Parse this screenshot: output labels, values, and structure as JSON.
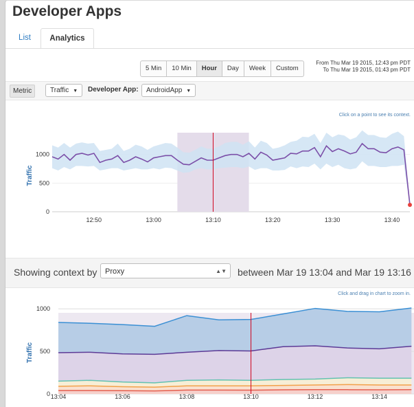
{
  "header": {
    "title": "Developer Apps"
  },
  "tabs": [
    {
      "label": "List"
    },
    {
      "label": "Analytics"
    }
  ],
  "time_range": {
    "options": [
      "5 Min",
      "10 Min",
      "Hour",
      "Day",
      "Week",
      "Custom"
    ],
    "selected": "Hour",
    "from_text": "From Thu Mar 19 2015, 12:43 pm PDT",
    "to_text": "To Thu Mar 19 2015, 01:43 pm PDT"
  },
  "filters": {
    "metric_label": "Metric",
    "metric_value": "Traffic",
    "app_label": "Developer App:",
    "app_value": "AndroidApp"
  },
  "chart1": {
    "hint": "Click on a point to see its context."
  },
  "context": {
    "label": "Showing context by",
    "dimension": "Proxy",
    "between_text": "between Mar 19 13:04 and Mar 19 13:16"
  },
  "chart2": {
    "hint": "Click and drag in chart to zoom in."
  },
  "colors": {
    "line1": "#7b4fa8",
    "band1": "#cfe3f3",
    "selection": "#e4dcea",
    "marker": "#d0021b",
    "point": "#e8413c",
    "blue_area": "#b7cde6",
    "blue_line": "#3a8fd4",
    "purple_area": "#ddd3e8",
    "purple_line": "#5c3a96",
    "teal_line": "#62c2b0",
    "orange_line": "#f2a14a",
    "red_line": "#e45e4f"
  },
  "chart_data": [
    {
      "type": "line",
      "title": "",
      "ylabel": "Traffic",
      "xlabel": "",
      "x_tick_labels": [
        "12:50",
        "13:00",
        "13:10",
        "13:20",
        "13:30",
        "13:40"
      ],
      "x_ticks_min": [
        7,
        17,
        27,
        37,
        47,
        57
      ],
      "y_ticks": [
        0,
        500,
        1000
      ],
      "xlim_min": [
        0,
        60
      ],
      "ylim": [
        0,
        1500
      ],
      "selection_min": [
        21,
        33
      ],
      "marker_min": [
        27
      ],
      "grid": true,
      "series": [
        {
          "values": [
            960,
            920,
            1000,
            900,
            1000,
            1020,
            990,
            1020,
            860,
            900,
            920,
            980,
            860,
            900,
            960,
            920,
            870,
            940,
            960,
            980,
            980,
            900,
            830,
            820,
            880,
            940,
            900,
            900,
            940,
            980,
            1000,
            1000,
            960,
            1020,
            920,
            1040,
            990,
            900,
            920,
            940,
            1020,
            1010,
            1060,
            1060,
            1120,
            960,
            1150,
            1050,
            1100,
            1060,
            1010,
            1040,
            1190,
            1100,
            1100,
            1040,
            1030,
            1100,
            1130,
            1080,
            120
          ],
          "band_low": [
            760,
            720,
            780,
            740,
            800,
            800,
            790,
            800,
            720,
            740,
            760,
            760,
            720,
            740,
            760,
            740,
            740,
            760,
            740,
            770,
            760,
            720,
            680,
            690,
            740,
            760,
            740,
            740,
            760,
            770,
            780,
            780,
            760,
            790,
            730,
            760,
            760,
            720,
            720,
            730,
            790,
            760,
            790,
            780,
            840,
            740,
            840,
            780,
            820,
            760,
            740,
            760,
            880,
            800,
            800,
            780,
            780,
            800,
            800,
            820,
            100
          ],
          "band_high": [
            1160,
            1120,
            1200,
            1120,
            1190,
            1210,
            1190,
            1200,
            1060,
            1080,
            1100,
            1190,
            1060,
            1100,
            1170,
            1140,
            1080,
            1140,
            1170,
            1200,
            1190,
            1120,
            1040,
            1030,
            1080,
            1140,
            1100,
            1100,
            1140,
            1200,
            1220,
            1220,
            1170,
            1230,
            1120,
            1240,
            1200,
            1100,
            1120,
            1160,
            1220,
            1240,
            1310,
            1300,
            1360,
            1200,
            1380,
            1300,
            1350,
            1330,
            1260,
            1300,
            1420,
            1340,
            1340,
            1300,
            1290,
            1360,
            1400,
            1320,
            140
          ]
        }
      ]
    },
    {
      "type": "area",
      "title": "",
      "ylabel": "Traffic",
      "x_tick_labels": [
        "13:04",
        "13:06",
        "13:08",
        "13:10",
        "13:12",
        "13:14"
      ],
      "x": [
        4,
        5,
        6,
        7,
        8,
        9,
        10,
        11,
        12,
        13,
        14,
        15
      ],
      "xlim": [
        4,
        15.1
      ],
      "y_ticks": [
        0,
        500,
        1000
      ],
      "ylim": [
        0,
        1050
      ],
      "marker_x": [
        10
      ],
      "series": [
        {
          "values": [
            840,
            830,
            815,
            795,
            920,
            870,
            875,
            940,
            1005,
            970,
            965,
            1010
          ]
        },
        {
          "values": [
            485,
            490,
            470,
            465,
            490,
            510,
            505,
            555,
            565,
            540,
            530,
            560
          ]
        },
        {
          "values": [
            150,
            160,
            140,
            130,
            160,
            165,
            160,
            170,
            175,
            190,
            185,
            185
          ]
        },
        {
          "values": [
            90,
            95,
            85,
            80,
            95,
            95,
            95,
            100,
            105,
            110,
            105,
            105
          ]
        },
        {
          "values": [
            40,
            40,
            38,
            35,
            45,
            45,
            44,
            48,
            50,
            50,
            48,
            50
          ]
        }
      ]
    }
  ]
}
